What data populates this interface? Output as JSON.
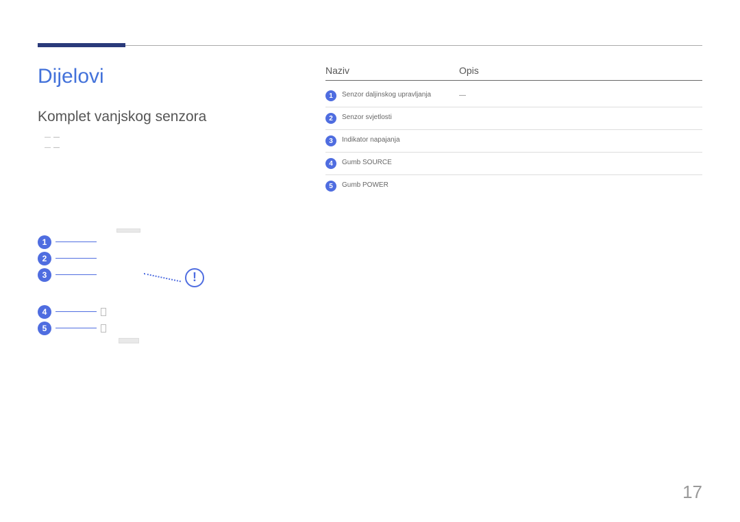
{
  "heading": "Dijelovi",
  "subheading": "Komplet vanjskog senzora",
  "side_notes": [
    "―",
    " ",
    "―",
    " "
  ],
  "diagram_numbers": [
    "1",
    "2",
    "3",
    "4",
    "5"
  ],
  "exclaim_label": "!",
  "table": {
    "headers": {
      "name": "Naziv",
      "desc": "Opis"
    },
    "rows": [
      {
        "num": "1",
        "name": "Senzor daljinskog upravljanja",
        "desc": " \n― "
      },
      {
        "num": "2",
        "name": "Senzor svjetlosti",
        "desc": " \n "
      },
      {
        "num": "3",
        "name": "Indikator napajanja",
        "desc": " "
      },
      {
        "num": "4",
        "name": "Gumb SOURCE",
        "desc": " \n "
      },
      {
        "num": "5",
        "name": "Gumb POWER",
        "desc": " "
      }
    ]
  },
  "page_number": "17"
}
